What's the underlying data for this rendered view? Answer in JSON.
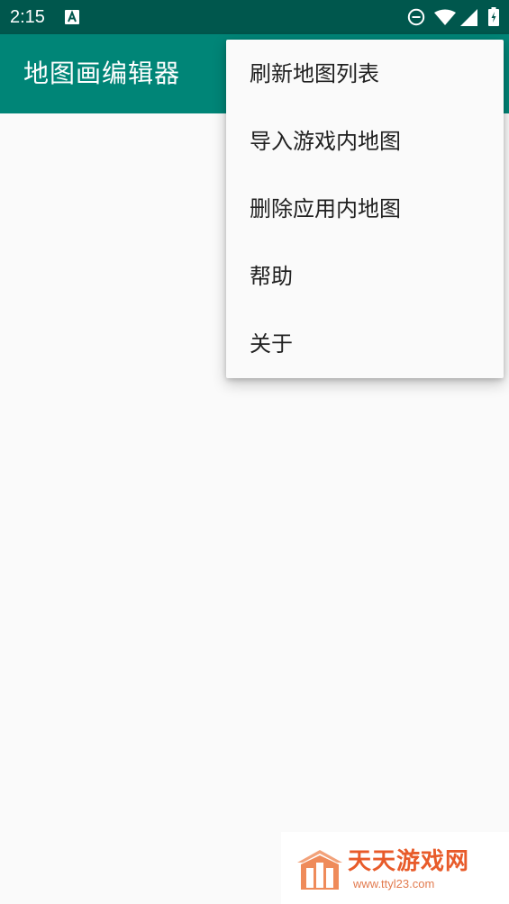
{
  "status_bar": {
    "time": "2:15",
    "icons": [
      "a-notification-icon",
      "dnd-icon",
      "wifi-icon",
      "cell-signal-icon",
      "battery-icon"
    ]
  },
  "app_bar": {
    "title": "地图画编辑器",
    "color": "#008577"
  },
  "overflow_menu": {
    "items": [
      {
        "label": "刷新地图列表"
      },
      {
        "label": "导入游戏内地图"
      },
      {
        "label": "删除应用内地图"
      },
      {
        "label": "帮助"
      },
      {
        "label": "关于"
      }
    ]
  },
  "watermark": {
    "name": "天天游戏网",
    "url": "www.ttyl23.com",
    "color": "#e85b2a"
  }
}
